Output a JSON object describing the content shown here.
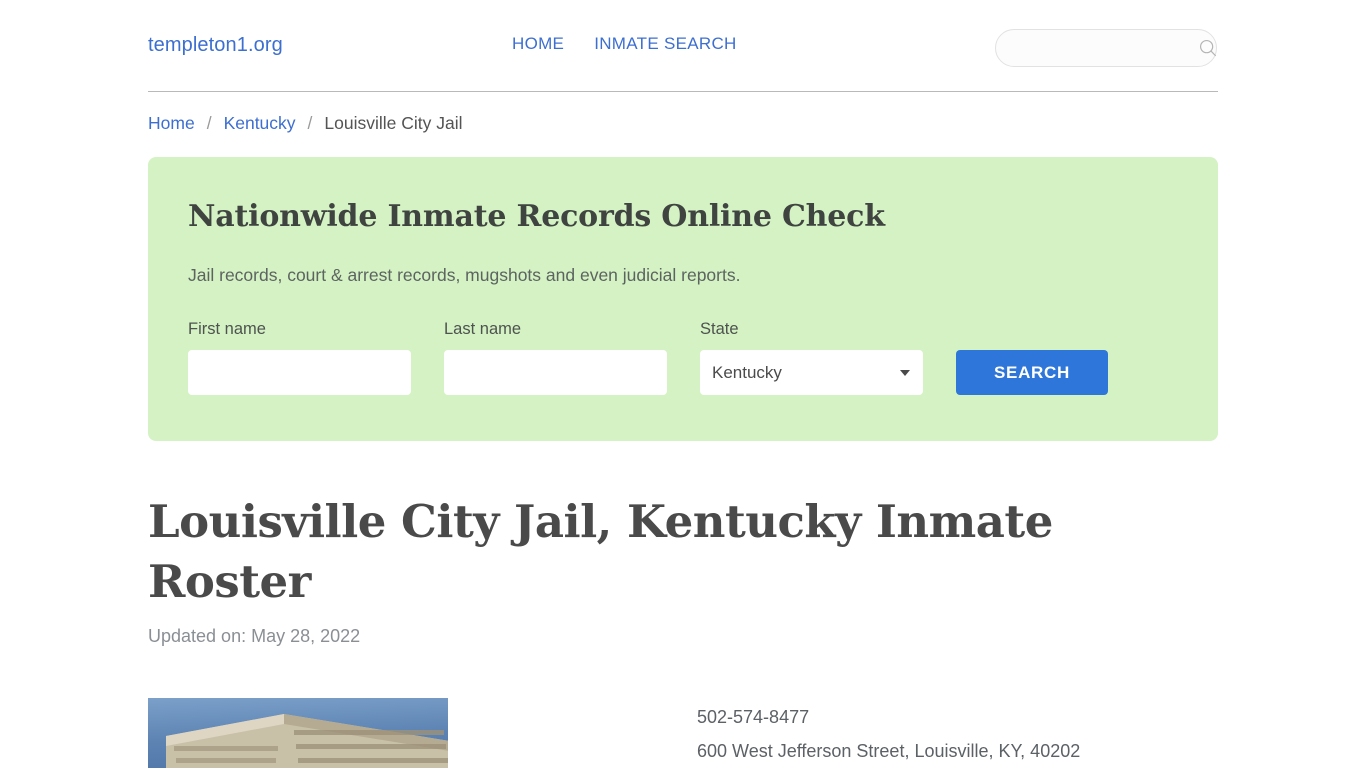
{
  "header": {
    "brand": "templeton1.org",
    "nav": [
      {
        "label": "HOME"
      },
      {
        "label": "INMATE SEARCH"
      }
    ],
    "search": {
      "value": "",
      "placeholder": "",
      "icon": "search-icon"
    }
  },
  "breadcrumb": {
    "items": [
      {
        "label": "Home",
        "current": false
      },
      {
        "label": "Kentucky",
        "current": false
      },
      {
        "label": "Louisville City Jail",
        "current": true
      }
    ],
    "separator": "/"
  },
  "promo": {
    "title": "Nationwide Inmate Records Online Check",
    "subtitle": "Jail records, court & arrest records, mugshots and even judicial reports.",
    "background_color": "#d5f2c4",
    "fields": {
      "first_name": {
        "label": "First name",
        "value": "",
        "placeholder": ""
      },
      "last_name": {
        "label": "Last name",
        "value": "",
        "placeholder": ""
      },
      "state": {
        "label": "State",
        "selected": "Kentucky",
        "options": [
          "Kentucky"
        ]
      }
    },
    "submit_label": "SEARCH",
    "submit_color": "#2e76d9"
  },
  "main": {
    "title": "Louisville City Jail, Kentucky Inmate Roster",
    "updated": "Updated on: May 28, 2022",
    "photo_alt": "Louisville City Jail building",
    "contact": {
      "phone": "502-574-8477",
      "address": "600 West Jefferson Street, Louisville, KY, 40202"
    }
  },
  "colors": {
    "link": "#3d6fd0",
    "text": "#4a4a4a",
    "muted": "#8a8f94"
  }
}
